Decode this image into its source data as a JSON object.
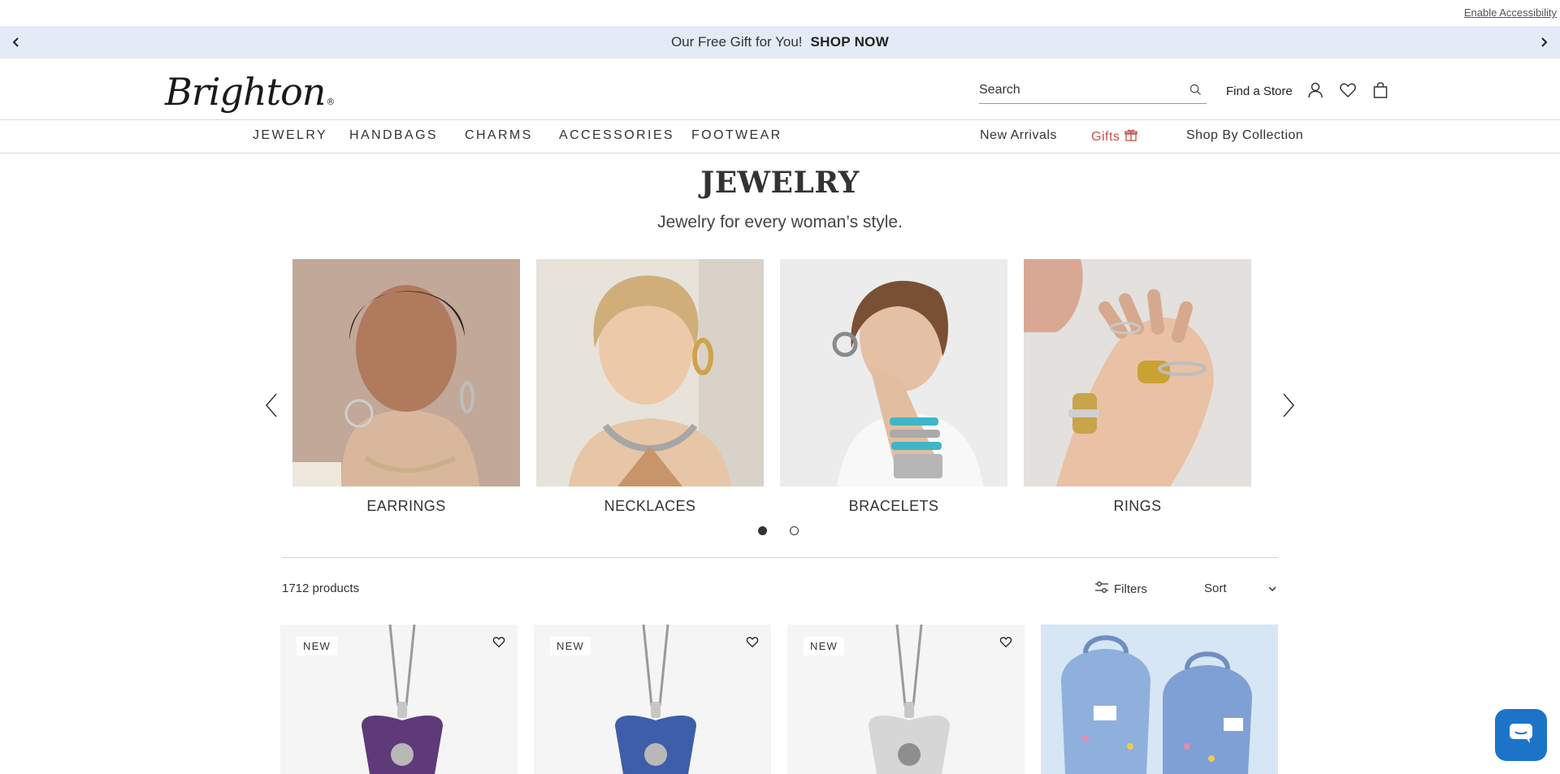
{
  "utility": {
    "accessibility_link": "Enable Accessibility"
  },
  "promo": {
    "text": "Our Free Gift for You!",
    "cta": "SHOP NOW"
  },
  "header": {
    "logo": "Brighton",
    "search_placeholder": "Search",
    "find_store": "Find a Store"
  },
  "nav": {
    "categories": [
      "JEWELRY",
      "HANDBAGS",
      "CHARMS",
      "ACCESSORIES",
      "FOOTWEAR"
    ],
    "new_arrivals": "New Arrivals",
    "gifts": "Gifts",
    "shop_by_collection": "Shop By Collection"
  },
  "page": {
    "title": "JEWELRY",
    "subtitle": "Jewelry for every woman’s style."
  },
  "carousel": {
    "tiles": [
      {
        "label": "EARRINGS"
      },
      {
        "label": "NECKLACES"
      },
      {
        "label": "BRACELETS"
      },
      {
        "label": "RINGS"
      }
    ],
    "pages": 2,
    "active_page": 1
  },
  "listing": {
    "count": "1712 products",
    "filters": "Filters",
    "sort": "Sort"
  },
  "products": [
    {
      "badge": "NEW",
      "stone_color": "#5e3a78"
    },
    {
      "badge": "NEW",
      "stone_color": "#3d5ea8"
    },
    {
      "badge": "NEW",
      "stone_color": "#d6d6d6"
    },
    {
      "badge": "",
      "stone_color": "#8fb0dc"
    }
  ],
  "colors": {
    "promo_bg": "#e3ebf6",
    "gifts_accent": "#c0504d",
    "chat_button": "#1c74c9"
  }
}
